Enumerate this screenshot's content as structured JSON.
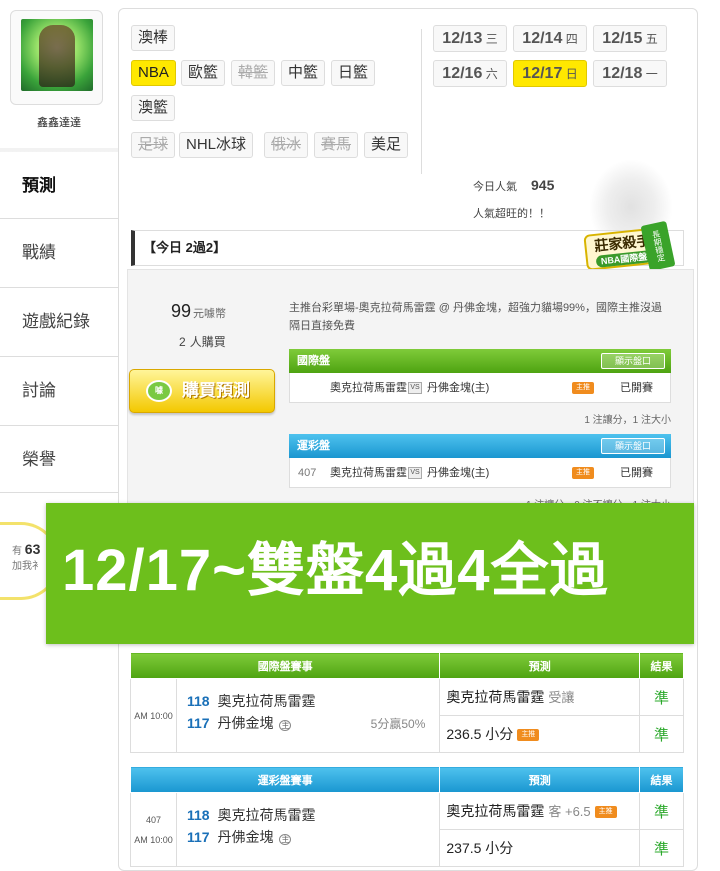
{
  "user": {
    "name": "鑫鑫達達"
  },
  "nav": [
    {
      "label": "預測"
    },
    {
      "label": "戰績"
    },
    {
      "label": "遊戲紀錄"
    },
    {
      "label": "討論"
    },
    {
      "label": "榮譽"
    }
  ],
  "fans": {
    "prefix": "有",
    "count": "63",
    "label": "加我衤"
  },
  "categories": {
    "row1": [
      {
        "label": "澳棒"
      }
    ],
    "row2": [
      {
        "label": "NBA"
      },
      {
        "label": "歐籃"
      },
      {
        "label": "韓籃"
      },
      {
        "label": "中籃"
      },
      {
        "label": "日籃"
      }
    ],
    "row3": [
      {
        "label": "澳籃"
      }
    ],
    "row4": [
      {
        "label": "足球"
      },
      {
        "label": "NHL冰球"
      },
      {
        "label": "俄冰"
      },
      {
        "label": "賽馬"
      },
      {
        "label": "美足"
      }
    ]
  },
  "dates": [
    {
      "md": "12/13",
      "wd": "三"
    },
    {
      "md": "12/14",
      "wd": "四"
    },
    {
      "md": "12/15",
      "wd": "五"
    },
    {
      "md": "12/16",
      "wd": "六"
    },
    {
      "md": "12/17",
      "wd": "日"
    },
    {
      "md": "12/18",
      "wd": "一"
    }
  ],
  "popularity": {
    "label": "今日人氣",
    "value": "945",
    "tagline": "人氣超旺的！！"
  },
  "badge": {
    "main": "莊家殺手",
    "sub": "NBA國際盤",
    "ribbon": "長期穩定"
  },
  "section_title": "【今日 2過2】",
  "package": {
    "price": "99",
    "price_unit": "元噱幣",
    "buyers": "2",
    "buyers_label": "人購買",
    "buy_button": "購買預測",
    "buy_icon": "噱",
    "description": "主推台彩單場-奧克拉荷馬雷霆 @ 丹佛金塊，超強力貓場99%，國際主推沒過隔日直接免費"
  },
  "panels": {
    "intl": {
      "title": "國際盤",
      "show": "顯示盤口",
      "away": "奧克拉荷馬雷霆",
      "vs": "VS",
      "home": "丹佛金塊(主)",
      "tag": "主推",
      "status": "已開賽",
      "note": "1 注讓分，1 注大小"
    },
    "lottery": {
      "title": "運彩盤",
      "show": "顯示盤口",
      "code": "407",
      "away": "奧克拉荷馬雷霆",
      "vs": "VS",
      "home": "丹佛金塊(主)",
      "tag": "主推",
      "status": "已開賽",
      "note": "1 注讓分，0 注不讓分，1 注大小"
    }
  },
  "banner": {
    "text": "12/17~雙盤4過4全過"
  },
  "results": {
    "intl": {
      "headers": [
        "國際盤賽事",
        "預測",
        "結果"
      ],
      "time": "AM 10:00",
      "away_no": "118",
      "away": "奧克拉荷馬雷霆",
      "home_no": "117",
      "home": "丹佛金塊",
      "home_mark": "主",
      "spread": "5分贏50%",
      "pick1": "奧克拉荷馬雷霆",
      "pick1_sub": "受讓",
      "res1": "準",
      "pick2": "236.5 小分",
      "pick2_tag": "主推",
      "res2": "準"
    },
    "lottery": {
      "headers": [
        "運彩盤賽事",
        "預測",
        "結果"
      ],
      "code": "407",
      "time": "AM 10:00",
      "away_no": "118",
      "away": "奧克拉荷馬雷霆",
      "home_no": "117",
      "home": "丹佛金塊",
      "home_mark": "主",
      "pick1": "奧克拉荷馬雷霆",
      "pick1_sub": "客 +6.5",
      "pick1_tag": "主推",
      "res1": "準",
      "pick2": "237.5 小分",
      "res2": "準"
    }
  },
  "colors": {
    "accent_yellow": "#ffe800",
    "green": "#6dbf1c",
    "blue": "#1a96d0",
    "win": "#2aa82a"
  }
}
